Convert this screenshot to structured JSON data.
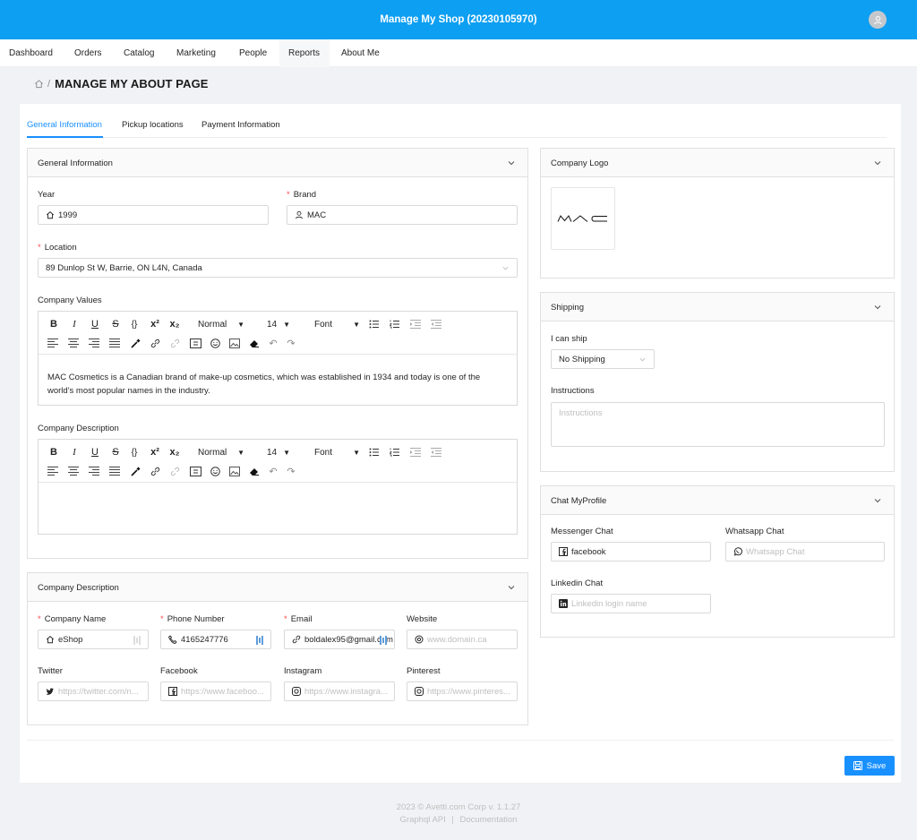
{
  "header": {
    "title": "Manage My Shop (20230105970)"
  },
  "nav": {
    "items": [
      "Dashboard",
      "Orders",
      "Catalog",
      "Marketing",
      "People",
      "Reports",
      "About Me"
    ]
  },
  "breadcrumb": {
    "separator": "/",
    "title": "MANAGE MY ABOUT PAGE"
  },
  "tabs": [
    "General Information",
    "Pickup locations",
    "Payment Information"
  ],
  "general": {
    "title": "General Information",
    "year_label": "Year",
    "year_value": "1999",
    "brand_label": "Brand",
    "brand_value": "MAC",
    "location_label": "Location",
    "location_value": "89 Dunlop St W, Barrie, ON L4N, Canada",
    "values_label": "Company Values",
    "values_text": "MAC Cosmetics is a Canadian brand of make-up cosmetics, which was established in 1934 and today is one of the world's most popular names in the industry.",
    "description_label": "Company Description",
    "toolbar": {
      "size": "Normal",
      "font_size": "14",
      "font": "Font",
      "code": "{}",
      "sup": "x²",
      "sub": "x₂",
      "bold": "B",
      "italic": "I",
      "underline": "U",
      "strike": "S"
    }
  },
  "company": {
    "title": "Company Description",
    "name_label": "Company Name",
    "name_value": "eShop",
    "phone_label": "Phone Number",
    "phone_value": "4165247776",
    "email_label": "Email",
    "email_value": "boldalex95@gmail.com",
    "website_label": "Website",
    "website_placeholder": "www.domain.ca",
    "twitter_label": "Twitter",
    "twitter_placeholder": "https://twitter.com/n...",
    "facebook_label": "Facebook",
    "facebook_placeholder": "https://www.faceboo...",
    "instagram_label": "Instagram",
    "instagram_placeholder": "https://www.instagra...",
    "pinterest_label": "Pinterest",
    "pinterest_placeholder": "https://www.pinteres..."
  },
  "logo": {
    "title": "Company Logo",
    "logo_text": "MAC"
  },
  "shipping": {
    "title": "Shipping",
    "ship_label": "I can ship",
    "ship_value": "No Shipping",
    "instructions_label": "Instructions",
    "instructions_placeholder": "Instructions"
  },
  "chat": {
    "title": "Chat MyProfile",
    "messenger_label": "Messenger Chat",
    "messenger_value": "facebook",
    "whatsapp_label": "Whatsapp Chat",
    "whatsapp_placeholder": "Whatsapp Chat",
    "linkedin_label": "Linkedin Chat",
    "linkedin_placeholder": "Linkedin login name"
  },
  "save_label": "Save",
  "footer": {
    "line1": "2023 © Avetti.com Corp v. 1.1.27",
    "api": "Graphql API",
    "sep": "|",
    "docs": "Documentation"
  },
  "colors": {
    "accent": "#1890ff",
    "topbar": "#0d9ff2",
    "required": "#ff4d4f"
  }
}
